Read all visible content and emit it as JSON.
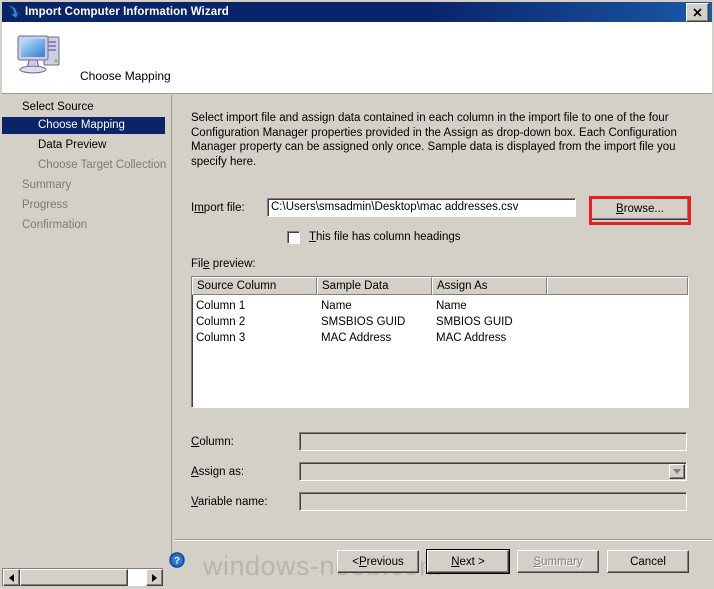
{
  "window": {
    "title": "Import Computer Information Wizard",
    "title_icon": "blue-arrow-icon",
    "close_label": "✕"
  },
  "header": {
    "icon": "computer-icon",
    "title": "Choose Mapping"
  },
  "sidebar": {
    "items": [
      {
        "label": "Select Source",
        "level": 0,
        "state": "normal"
      },
      {
        "label": "Choose Mapping",
        "level": 1,
        "state": "selected"
      },
      {
        "label": "Data Preview",
        "level": 1,
        "state": "normal"
      },
      {
        "label": "Choose Target Collection",
        "level": 1,
        "state": "dim"
      },
      {
        "label": "Summary",
        "level": 0,
        "state": "dim"
      },
      {
        "label": "Progress",
        "level": 0,
        "state": "dim"
      },
      {
        "label": "Confirmation",
        "level": 0,
        "state": "dim"
      }
    ]
  },
  "main": {
    "instructions": "Select import file and assign data contained in each column in the import file to one of the four Configuration Manager properties provided in the Assign as drop-down box. Each Configuration Manager property can be assigned only once. Sample data is displayed from the import file you specify here.",
    "import_file": {
      "label_pre": "I",
      "label_accel": "m",
      "label_post": "port file:",
      "value": "C:\\Users\\smsadmin\\Desktop\\mac addresses.csv",
      "browse_label_accel": "B",
      "browse_label_post": "rowse..."
    },
    "column_headings_checkbox": {
      "accel": "T",
      "label_post": "his file has column headings",
      "checked": false
    },
    "file_preview_label": {
      "pre": "Fil",
      "accel": "e",
      "post": " preview:"
    },
    "preview_table": {
      "columns": [
        "Source Column",
        "Sample Data",
        "Assign As",
        ""
      ],
      "rows": [
        [
          "Column 1",
          "Name",
          "Name",
          ""
        ],
        [
          "Column 2",
          "SMSBIOS GUID",
          "SMBIOS GUID",
          ""
        ],
        [
          "Column 3",
          "MAC Address",
          "MAC Address",
          ""
        ]
      ]
    },
    "fields": [
      {
        "accel": "C",
        "label_post": "olumn:",
        "value": "",
        "type": "text",
        "disabled": true
      },
      {
        "accel": "A",
        "label_post": "ssign as:",
        "value": "",
        "type": "combo",
        "disabled": true
      },
      {
        "accel": "V",
        "label_post": "ariable name:",
        "value": "",
        "type": "text",
        "disabled": true
      }
    ]
  },
  "footer": {
    "help_icon": "help-question-icon",
    "buttons": [
      {
        "name": "previous",
        "pre": "< ",
        "accel": "P",
        "post": "revious",
        "disabled": false,
        "default": false
      },
      {
        "name": "next",
        "pre": "",
        "accel": "N",
        "post": "ext >",
        "disabled": false,
        "default": true
      },
      {
        "name": "summary",
        "pre": "",
        "accel": "S",
        "post": "ummary",
        "disabled": true,
        "default": false
      },
      {
        "name": "cancel",
        "pre": "",
        "accel": "",
        "post": "Cancel",
        "disabled": false,
        "default": false
      }
    ]
  },
  "watermark": {
    "text": "windows-noob.com"
  },
  "colors": {
    "titlebar": "#0a246a",
    "face": "#d4d0c8",
    "selection": "#0a246a",
    "highlight_annotation": "#ee1c1c"
  }
}
